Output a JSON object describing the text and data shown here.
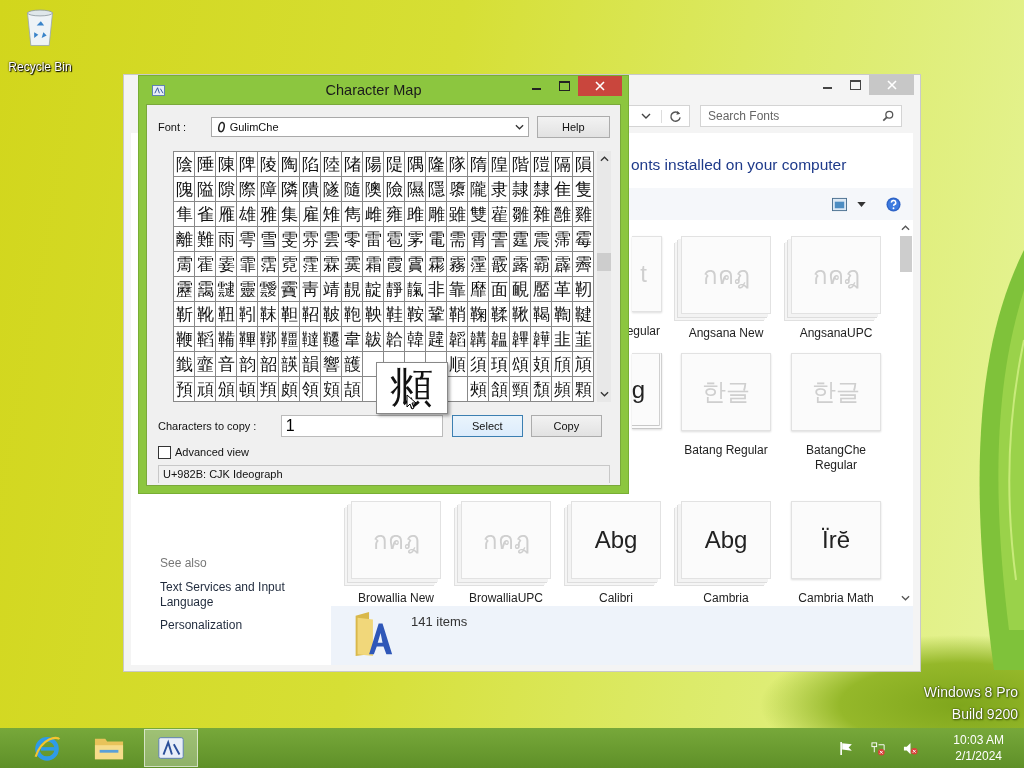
{
  "desktop": {
    "icons": [
      {
        "label": "Recycle Bin"
      }
    ],
    "edition": [
      "Windows 8 Pro",
      "Build 9200"
    ]
  },
  "fonts_window": {
    "search": {
      "placeholder": "Search Fonts"
    },
    "heading": "onts installed on your computer",
    "tile_rows": [
      [
        {
          "kind": "partial",
          "preview": "t",
          "label": "egular",
          "hidden": true,
          "stacked": false
        },
        {
          "kind": "font",
          "preview": "กคฎ",
          "label": "Angsana New",
          "hidden": true,
          "stacked": true
        },
        {
          "kind": "font",
          "preview": "กคฎ",
          "label": "AngsanaUPC",
          "hidden": true,
          "stacked": true
        }
      ],
      [
        {
          "kind": "partial",
          "preview": "g",
          "hidden": false,
          "stacked": true
        },
        {
          "kind": "font",
          "preview": "한글",
          "label": "Batang Regular",
          "hidden": true,
          "stacked": false
        },
        {
          "kind": "font",
          "preview": "한글",
          "label": "BatangChe Regular",
          "hidden": true,
          "stacked": false
        }
      ],
      [
        {
          "kind": "font",
          "preview": "กคฎ",
          "label": "Browallia New",
          "hidden": true,
          "stacked": true
        },
        {
          "kind": "font",
          "preview": "กคฎ",
          "label": "BrowalliaUPC",
          "hidden": true,
          "stacked": true
        },
        {
          "kind": "font",
          "preview": "Abg",
          "label": "Calibri",
          "hidden": false,
          "stacked": true
        },
        {
          "kind": "font",
          "preview": "Abg",
          "label": "Cambria",
          "hidden": false,
          "stacked": true
        },
        {
          "kind": "font",
          "preview": "Ïrĕ",
          "label": "Cambria Math",
          "hidden": false,
          "stacked": false
        }
      ]
    ],
    "see_also": {
      "title": "See also",
      "links": [
        "Text Services and Input Language",
        "Personalization"
      ]
    },
    "details": "141 items"
  },
  "charmap": {
    "title": "Character Map",
    "font_label": "Font :",
    "font": "GulimChe",
    "help": "Help",
    "grid": [
      [
        "陰",
        "陲",
        "陳",
        "陴",
        "陵",
        "陶",
        "陷",
        "陸",
        "陼",
        "陽",
        "隄",
        "隅",
        "隆",
        "隊",
        "隋",
        "隍",
        "階",
        "隑",
        "隔",
        "隕"
      ],
      [
        "隗",
        "隘",
        "隙",
        "際",
        "障",
        "隣",
        "隤",
        "隧",
        "隨",
        "隩",
        "險",
        "隰",
        "隱",
        "隳",
        "隴",
        "隶",
        "隷",
        "隸",
        "隹",
        "隻"
      ],
      [
        "隼",
        "雀",
        "雁",
        "雄",
        "雅",
        "集",
        "雇",
        "雉",
        "雋",
        "雌",
        "雍",
        "雎",
        "雕",
        "雖",
        "雙",
        "雚",
        "雛",
        "雜",
        "雝",
        "雞"
      ],
      [
        "離",
        "難",
        "雨",
        "雩",
        "雪",
        "雯",
        "雰",
        "雲",
        "零",
        "雷",
        "雹",
        "雺",
        "電",
        "需",
        "霄",
        "霅",
        "霆",
        "震",
        "霈",
        "霉"
      ],
      [
        "霌",
        "霍",
        "霎",
        "霏",
        "霑",
        "霓",
        "霔",
        "霖",
        "霙",
        "霜",
        "霞",
        "霣",
        "霦",
        "霧",
        "霪",
        "霰",
        "露",
        "霸",
        "霹",
        "霽"
      ],
      [
        "靂",
        "靄",
        "靆",
        "靈",
        "靉",
        "靌",
        "靑",
        "靖",
        "靚",
        "靛",
        "靜",
        "靝",
        "非",
        "靠",
        "靡",
        "面",
        "靦",
        "靨",
        "革",
        "靭"
      ],
      [
        "靳",
        "靴",
        "靵",
        "靷",
        "靺",
        "靼",
        "鞀",
        "鞁",
        "鞄",
        "鞅",
        "鞋",
        "鞍",
        "鞏",
        "鞘",
        "鞠",
        "鞣",
        "鞦",
        "鞨",
        "鞫",
        "鞬"
      ],
      [
        "鞭",
        "鞱",
        "鞴",
        "鞸",
        "鞹",
        "韁",
        "韃",
        "韆",
        "韋",
        "韍",
        "韐",
        "韓",
        "韙",
        "韜",
        "韝",
        "韞",
        "韠",
        "韡",
        "韭",
        "韮"
      ],
      {
        "left": [
          "韱",
          "韲",
          "音",
          "韵",
          "韶",
          "韺",
          "韻",
          "響",
          "頀"
        ],
        "right": [
          "順",
          "須",
          "頊",
          "頌",
          "頍",
          "頎",
          "頏"
        ]
      },
      {
        "left": [
          "預",
          "頑",
          "頒",
          "頓",
          "頖",
          "頗",
          "領",
          "頞",
          "頡"
        ],
        "right": [
          "頰",
          "頷",
          "頸",
          "頹",
          "頻",
          "顆"
        ]
      }
    ],
    "magnified": "頫",
    "copy_label": "Characters to copy :",
    "copy_value": "1",
    "select": "Select",
    "copy": "Copy",
    "advanced": {
      "label": "Advanced view",
      "checked": false
    },
    "status": "U+982B: CJK Ideograph"
  },
  "taskbar": {
    "buttons": [
      {
        "kind": "browser",
        "selected": false
      },
      {
        "kind": "folder",
        "selected": false
      },
      {
        "kind": "charmap",
        "selected": true
      }
    ],
    "time": "10:03 AM",
    "date": "2/1/2024"
  }
}
